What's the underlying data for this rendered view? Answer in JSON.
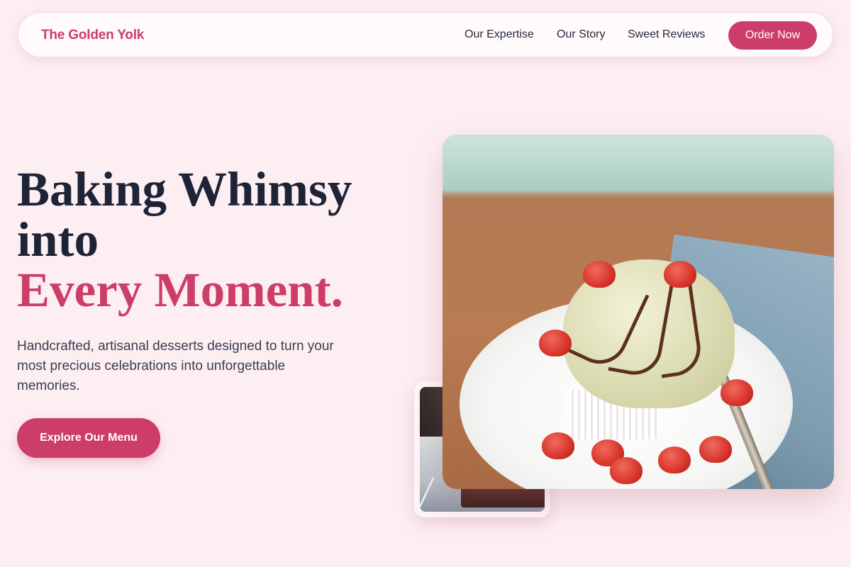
{
  "brand": {
    "name": "The Golden Yolk"
  },
  "nav": {
    "links": [
      "Our Expertise",
      "Our Story",
      "Sweet Reviews"
    ],
    "cta_label": "Order Now"
  },
  "hero": {
    "headline_line1": "Baking Whimsy",
    "headline_line2": "into",
    "headline_accent": "Every Moment.",
    "subcopy": "Handcrafted, artisanal desserts designed to turn your most precious celebrations into unforgettable memories.",
    "cta_label": "Explore Our Menu"
  },
  "colors": {
    "background": "#fdeef2",
    "accent": "#cc3d6a",
    "heading": "#1d2438",
    "body_text": "#3a3f52"
  },
  "images": {
    "hero_main": "ice-cream-dessert-with-strawberries-photo",
    "hero_thumb": "brownie-with-fork-photo"
  }
}
